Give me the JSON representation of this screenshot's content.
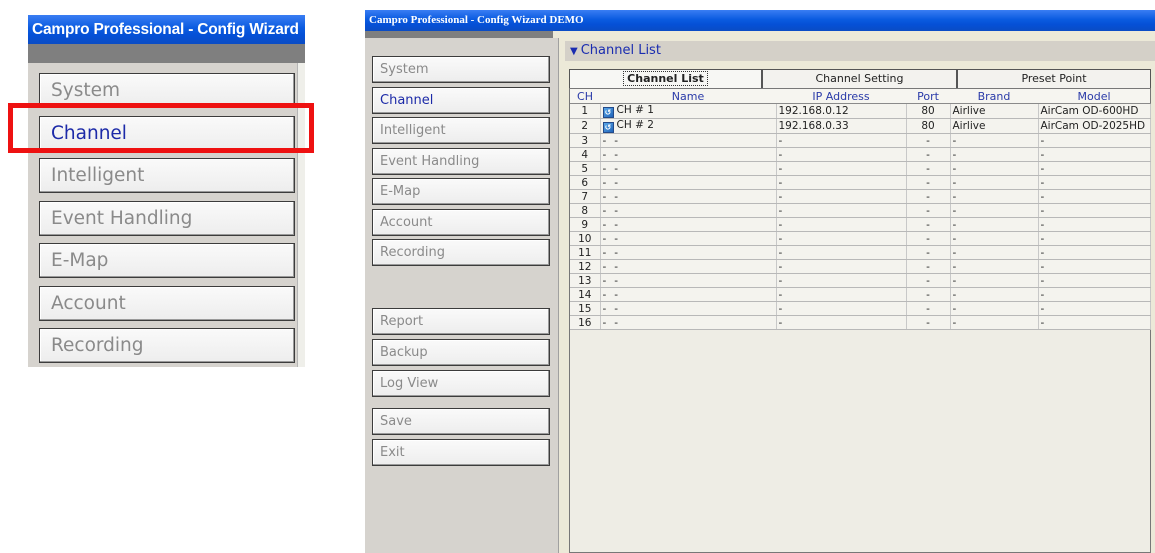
{
  "zoom": {
    "title": "Campro Professional - Config Wizard",
    "nav": [
      "System",
      "Channel",
      "Intelligent",
      "Event Handling",
      "E-Map",
      "Account",
      "Recording"
    ],
    "active": "Channel",
    "highlight_color": "#ee1111"
  },
  "window": {
    "title": "Campro Professional - Config Wizard DEMO",
    "nav_top": [
      "System",
      "Channel",
      "Intelligent",
      "Event Handling",
      "E-Map",
      "Account",
      "Recording"
    ],
    "nav_bottom": [
      "Report",
      "Backup",
      "Log View"
    ],
    "nav_actions": [
      "Save",
      "Exit"
    ],
    "active": "Channel",
    "section_title": "Channel List",
    "tabs": [
      "Channel List",
      "Channel Setting",
      "Preset Point"
    ],
    "selected_tab": "Channel List",
    "table": {
      "headers": [
        "CH",
        "Name",
        "IP Address",
        "Port",
        "Brand",
        "Model"
      ],
      "rows": [
        {
          "ch": "1",
          "icon": true,
          "name": "CH # 1",
          "ip": "192.168.0.12",
          "port": "80",
          "brand": "Airlive",
          "model": "AirCam OD-600HD"
        },
        {
          "ch": "2",
          "icon": true,
          "name": "CH # 2",
          "ip": "192.168.0.33",
          "port": "80",
          "brand": "Airlive",
          "model": "AirCam OD-2025HD"
        },
        {
          "ch": "3",
          "icon": false,
          "name": "-",
          "ip": "-",
          "port": "-",
          "brand": "-",
          "model": "-"
        },
        {
          "ch": "4",
          "icon": false,
          "name": "-",
          "ip": "-",
          "port": "-",
          "brand": "-",
          "model": "-"
        },
        {
          "ch": "5",
          "icon": false,
          "name": "-",
          "ip": "-",
          "port": "-",
          "brand": "-",
          "model": "-"
        },
        {
          "ch": "6",
          "icon": false,
          "name": "-",
          "ip": "-",
          "port": "-",
          "brand": "-",
          "model": "-"
        },
        {
          "ch": "7",
          "icon": false,
          "name": "-",
          "ip": "-",
          "port": "-",
          "brand": "-",
          "model": "-"
        },
        {
          "ch": "8",
          "icon": false,
          "name": "-",
          "ip": "-",
          "port": "-",
          "brand": "-",
          "model": "-"
        },
        {
          "ch": "9",
          "icon": false,
          "name": "-",
          "ip": "-",
          "port": "-",
          "brand": "-",
          "model": "-"
        },
        {
          "ch": "10",
          "icon": false,
          "name": "-",
          "ip": "-",
          "port": "-",
          "brand": "-",
          "model": "-"
        },
        {
          "ch": "11",
          "icon": false,
          "name": "-",
          "ip": "-",
          "port": "-",
          "brand": "-",
          "model": "-"
        },
        {
          "ch": "12",
          "icon": false,
          "name": "-",
          "ip": "-",
          "port": "-",
          "brand": "-",
          "model": "-"
        },
        {
          "ch": "13",
          "icon": false,
          "name": "-",
          "ip": "-",
          "port": "-",
          "brand": "-",
          "model": "-"
        },
        {
          "ch": "14",
          "icon": false,
          "name": "-",
          "ip": "-",
          "port": "-",
          "brand": "-",
          "model": "-"
        },
        {
          "ch": "15",
          "icon": false,
          "name": "-",
          "ip": "-",
          "port": "-",
          "brand": "-",
          "model": "-"
        },
        {
          "ch": "16",
          "icon": false,
          "name": "-",
          "ip": "-",
          "port": "-",
          "brand": "-",
          "model": "-"
        }
      ]
    }
  }
}
